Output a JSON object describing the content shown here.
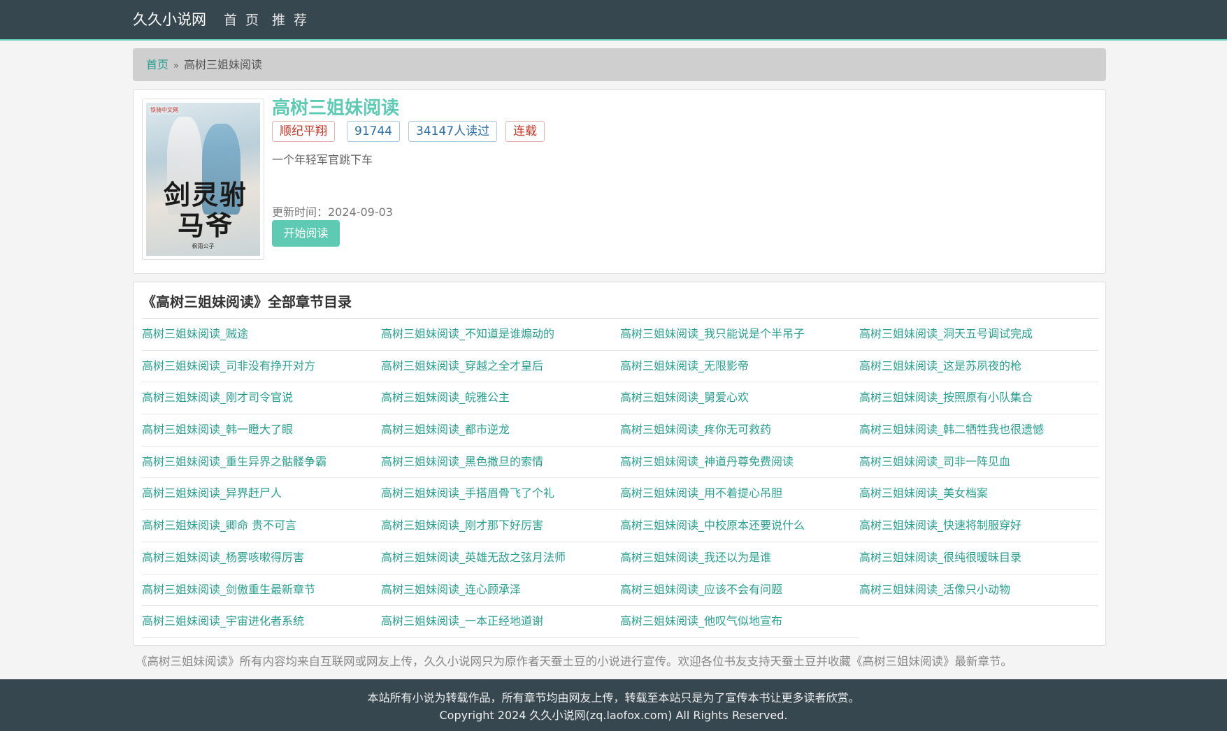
{
  "navbar": {
    "brand": "久久小说网",
    "links": [
      "首 页",
      "推 荐"
    ]
  },
  "breadcrumb": {
    "home": "首页",
    "separator": "»",
    "current": "高树三姐妹阅读"
  },
  "book": {
    "title": "高树三姐妹阅读",
    "author": "顺纪平翔",
    "words": "91744",
    "reads": "34147人读过",
    "status": "连载",
    "intro": "一个年轻军官跳下车",
    "update_time": "更新时间：2024-09-03",
    "start_button": "开始阅读",
    "cover": {
      "title": "剑灵驸马爷",
      "publisher": "铁骑中文网",
      "author": "枫雨公子"
    }
  },
  "chapters": {
    "heading": "《高树三姐妹阅读》全部章节目录",
    "items": [
      "高树三姐妹阅读_贼途",
      "高树三姐妹阅读_不知道是谁煽动的",
      "高树三姐妹阅读_我只能说是个半吊子",
      "高树三姐妹阅读_洞天五号调试完成",
      "高树三姐妹阅读_司非没有挣开对方",
      "高树三姐妹阅读_穿越之全才皇后",
      "高树三姐妹阅读_无限影帝",
      "高树三姐妹阅读_这是苏夙夜的枪",
      "高树三姐妹阅读_刚才司令官说",
      "高树三姐妹阅读_皖雅公主",
      "高树三姐妹阅读_舅爱心欢",
      "高树三姐妹阅读_按照原有小队集合",
      "高树三姐妹阅读_韩一瞪大了眼",
      "高树三姐妹阅读_都市逆龙",
      "高树三姐妹阅读_疼你无可救药",
      "高树三姐妹阅读_韩二牺牲我也很遗憾",
      "高树三姐妹阅读_重生异界之骷髅争霸",
      "高树三姐妹阅读_黑色撒旦的索情",
      "高树三姐妹阅读_神道丹尊免费阅读",
      "高树三姐妹阅读_司非一阵见血",
      "高树三姐妹阅读_异界赶尸人",
      "高树三姐妹阅读_手搭眉骨飞了个礼",
      "高树三姐妹阅读_用不着提心吊胆",
      "高树三姐妹阅读_美女档案",
      "高树三姐妹阅读_卿命 贵不可言",
      "高树三姐妹阅读_刚才那下好厉害",
      "高树三姐妹阅读_中校原本还要说什么",
      "高树三姐妹阅读_快速将制服穿好",
      "高树三姐妹阅读_杨雾咳嗽得厉害",
      "高树三姐妹阅读_英雄无敌之弦月法师",
      "高树三姐妹阅读_我还以为是谁",
      "高树三姐妹阅读_很纯很暧昧目录",
      "高树三姐妹阅读_剑傲重生最新章节",
      "高树三姐妹阅读_连心顾承泽",
      "高树三姐妹阅读_应该不会有问题",
      "高树三姐妹阅读_活像只小动物",
      "高树三姐妹阅读_宇宙进化者系统",
      "高树三姐妹阅读_一本正经地道谢",
      "高树三姐妹阅读_他叹气似地宣布"
    ]
  },
  "disclaimer": "《高树三姐妹阅读》所有内容均来自互联网或网友上传，久久小说网只为原作者天蚕土豆的小说进行宣传。欢迎各位书友支持天蚕土豆并收藏《高树三姐妹阅读》最新章节。",
  "footer": {
    "line1": "本站所有小说为转载作品，所有章节均由网友上传，转载至本站只是为了宣传本书让更多读者欣赏。",
    "line2": "Copyright 2024 久久小说网(zq.laofox.com) All Rights Reserved."
  },
  "colors": {
    "navbar_bg": "#37474f",
    "accent": "#5fcab4",
    "link": "#2a9d8f",
    "tag_red": "#c0392b",
    "tag_blue": "#2c6da0"
  }
}
